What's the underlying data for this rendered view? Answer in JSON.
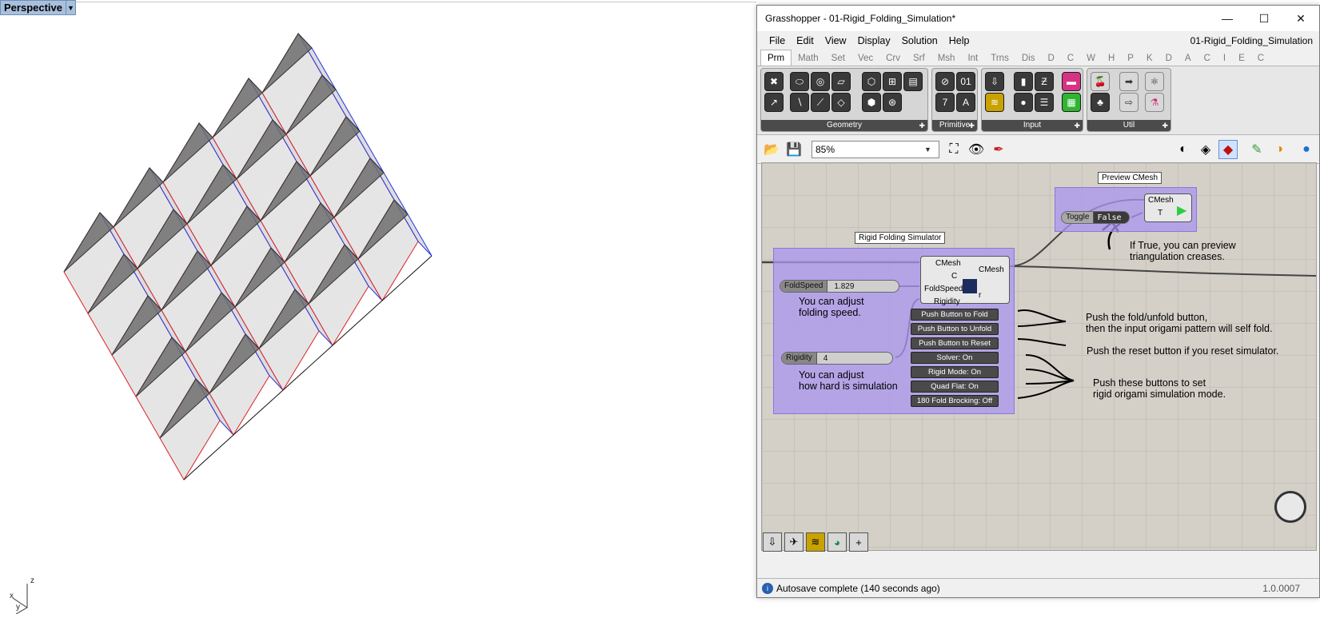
{
  "viewport": {
    "name": "Perspective",
    "axis_x": "x",
    "axis_y": "y",
    "axis_z": "z"
  },
  "window": {
    "title": "Grasshopper - 01-Rigid_Folding_Simulation*",
    "doc_name": "01-Rigid_Folding_Simulation",
    "minimize": "—",
    "maximize": "☐",
    "close": "✕"
  },
  "menu": [
    "File",
    "Edit",
    "View",
    "Display",
    "Solution",
    "Help"
  ],
  "tabs": [
    "Prm",
    "Math",
    "Set",
    "Vec",
    "Crv",
    "Srf",
    "Msh",
    "Int",
    "Trns",
    "Dis",
    "D",
    "C",
    "W",
    "H",
    "P",
    "K",
    "D",
    "A",
    "C",
    "I",
    "E",
    "C"
  ],
  "ribbon_panels": [
    "Geometry",
    "Primitive",
    "Input",
    "Util"
  ],
  "toolbar": {
    "zoom": "85%"
  },
  "canvas": {
    "group_main_label": "Rigid Folding Simulator",
    "group_preview_label": "Preview CMesh",
    "component": {
      "inputs": [
        "CMesh",
        "C",
        "FoldSpeed",
        "Rigidity"
      ],
      "outputs": [
        "CMesh",
        "r"
      ]
    },
    "buttons": [
      "Push Button to Fold",
      "Push Button to Unfold",
      "Push Button to Reset",
      "Solver: On",
      "Rigid Mode: On",
      "Quad Flat: On",
      "180 Fold Brocking: Off"
    ],
    "sliders": [
      {
        "name": "FoldSpeed",
        "value": "1.829"
      },
      {
        "name": "Rigidity",
        "value": "4"
      }
    ],
    "toggle": {
      "name": "Toggle",
      "value": "False"
    },
    "preview": {
      "in1": "CMesh",
      "in2": "T"
    },
    "notes": {
      "speed_1": "You can adjust",
      "speed_2": "folding speed.",
      "rigidity_1": "You can adjust",
      "rigidity_2": "how hard is simulation",
      "preview_1": "If True, you can preview",
      "preview_2": "triangulation creases.",
      "fold_1": "Push the fold/unfold button,",
      "fold_2": "then the input origami pattern will self fold.",
      "reset": "Push the reset button if you reset simulator.",
      "mode_1": "Push these buttons to set",
      "mode_2": "rigid origami simulation mode."
    }
  },
  "status": {
    "text": "Autosave complete (140 seconds ago)",
    "version": "1.0.0007"
  },
  "colors": {
    "group_fill": "#aa96f0",
    "crease_red": "#e02020",
    "crease_blue": "#2030e0",
    "canvas_bg": "#d4d0c8"
  }
}
